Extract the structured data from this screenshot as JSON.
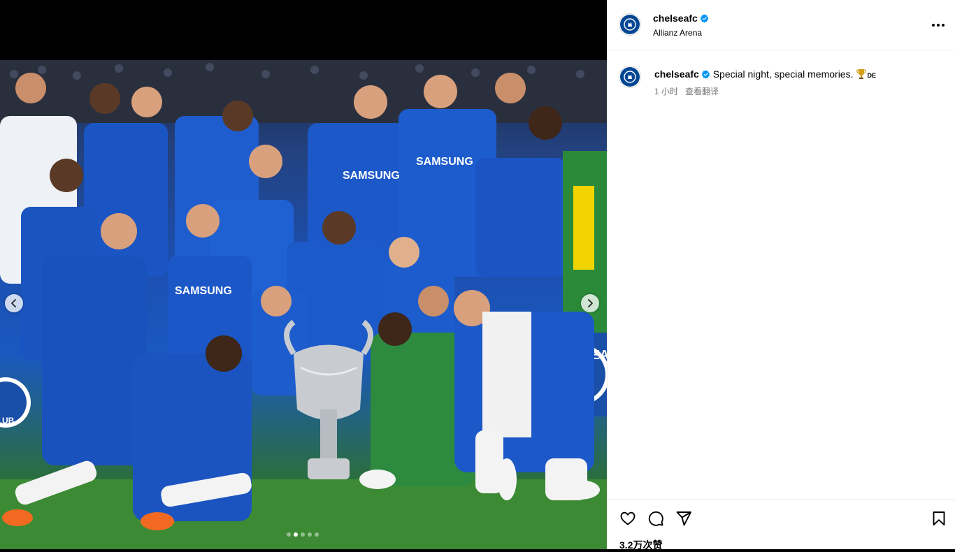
{
  "post": {
    "username": "chelseafc",
    "location": "Allianz Arena",
    "caption": "Special night, special memories.",
    "caption_flag": "DE",
    "time_ago": "1 小时",
    "translate_label": "查看翻译",
    "likes": "3.2万次赞"
  },
  "media": {
    "carousel_total": 5,
    "carousel_active": 2,
    "banner_text": "CHELSEA",
    "banner_left_text": "LUB",
    "shirt_text": "SAMSUNG"
  },
  "icons": {
    "verified": "verified-badge-icon",
    "more": "more-options-icon",
    "like": "heart-icon",
    "comment": "comment-icon",
    "share": "send-icon",
    "save": "bookmark-icon",
    "prev": "chevron-left-icon",
    "next": "chevron-right-icon",
    "trophy": "trophy-emoji-icon"
  },
  "colors": {
    "chelsea_blue": "#034694",
    "verified_blue": "#0095f6",
    "secondary_text": "#737373"
  }
}
